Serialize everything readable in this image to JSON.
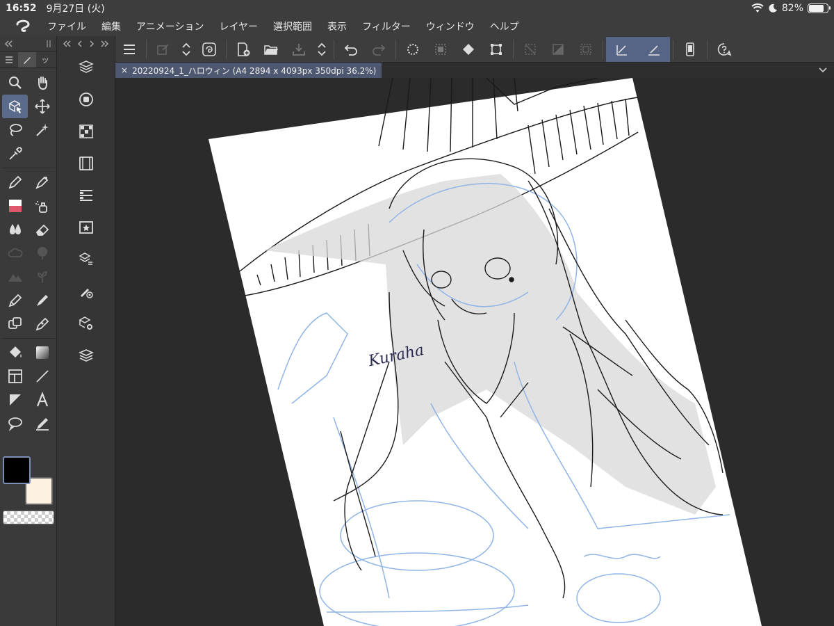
{
  "status_bar": {
    "time": "16:52",
    "date": "9月27日 (火)",
    "battery": "82%",
    "battery_level": 0.82
  },
  "menu": {
    "items": [
      "ファイル",
      "編集",
      "アニメーション",
      "レイヤー",
      "選択範囲",
      "表示",
      "フィルター",
      "ウィンドウ",
      "ヘルプ"
    ]
  },
  "tool_palette": {
    "header_icons": [
      "collapse-left-icon",
      "drag-handle-icon"
    ],
    "tab_icons": [
      "list-icon",
      "brush-tab-icon",
      "ッ"
    ]
  },
  "document": {
    "tab_title": "20220924_1_ハロウィン (A4 2894 x 4093px 350dpi 36.2%)",
    "close_glyph": "×"
  },
  "canvas": {
    "signature": "Kuraha"
  },
  "colors": {
    "main": "#000000",
    "sub": "#fdf1e2",
    "accent": "#5a6a8a",
    "sketch_blue": "#8fb4e6"
  }
}
